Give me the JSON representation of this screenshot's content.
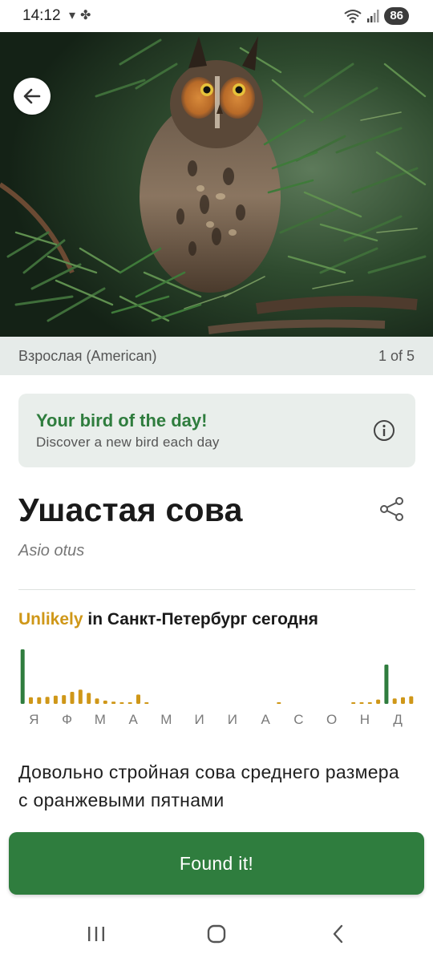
{
  "status_bar": {
    "time": "14:12",
    "left_icons": [
      "download-arrow-icon",
      "pinwheel-icon"
    ],
    "right_icons": [
      "wifi-icon",
      "signal-icon"
    ],
    "battery": "86"
  },
  "hero": {
    "image": "long-eared-owl-photo",
    "back_icon": "arrow-left-icon"
  },
  "caption": {
    "label": "Взрослая (American)",
    "counter": "1 of 5"
  },
  "bird_of_day": {
    "title": "Your bird of the day!",
    "subtitle": "Discover a new bird each day",
    "icon": "info-icon"
  },
  "bird": {
    "name": "Ушастая сова",
    "latin": "Asio otus",
    "share_icon": "share-icon"
  },
  "likelihood": {
    "status": "Unlikely",
    "rest": " in Санкт-Петербург сегодня",
    "colors": {
      "highlight": "#2f7d3e",
      "normal": "#cf9718",
      "trace": "#bbbbbb"
    }
  },
  "chart_data": {
    "type": "bar",
    "categories": [
      "Я",
      "Ф",
      "М",
      "А",
      "М",
      "И",
      "И",
      "А",
      "С",
      "О",
      "Н",
      "Д"
    ],
    "bars_per_month": 4,
    "values": [
      1.0,
      0.12,
      0.12,
      0.13,
      0.15,
      0.16,
      0.22,
      0.26,
      0.2,
      0.1,
      0.06,
      0.04,
      0.02,
      0.03,
      0.17,
      0.02,
      0,
      0,
      0,
      0,
      0,
      0,
      0,
      0,
      0,
      0,
      0,
      0,
      0,
      0,
      0,
      0.02,
      0,
      0,
      0,
      0,
      0,
      0,
      0,
      0,
      0.02,
      0.02,
      0.02,
      0.08,
      0.72,
      0.1,
      0.12,
      0.14
    ],
    "highlight_indices": [
      0,
      44
    ],
    "ylim": [
      0,
      1
    ]
  },
  "description": "Довольно стройная сова среднего размера с оранжевыми пятнами",
  "found_button": {
    "label": "Found it!"
  },
  "nav_bar": {
    "recents_icon": "recents-icon",
    "home_icon": "home-icon",
    "back_icon": "back-chevron-icon"
  }
}
